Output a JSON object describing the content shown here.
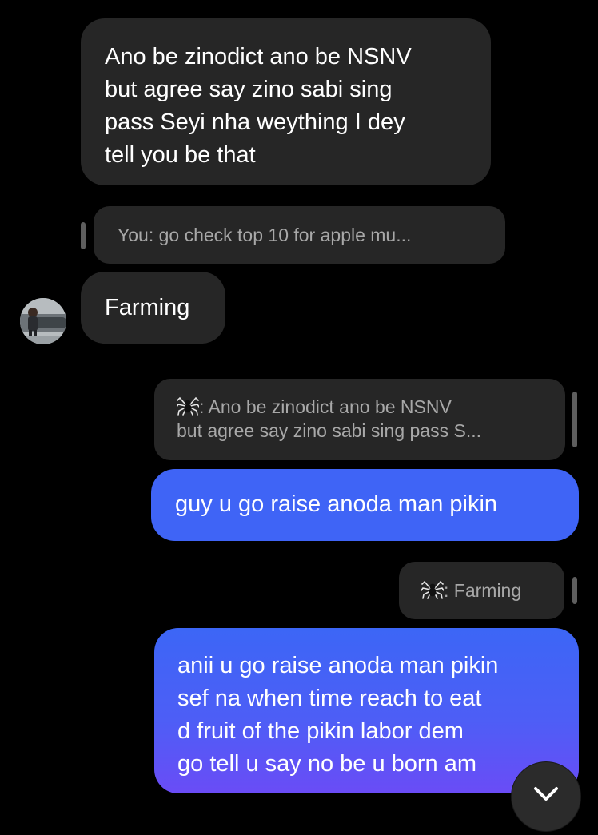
{
  "messages": [
    {
      "type": "incoming",
      "lines": [
        "Ano be zinodict ano be NSNV",
        "but agree say zino sabi sing",
        "pass Seyi nha weything I dey",
        "tell you be that"
      ]
    },
    {
      "type": "reply_preview_incoming",
      "text": "You: go check top 10 for apple mu..."
    },
    {
      "type": "incoming",
      "text": "Farming"
    },
    {
      "type": "reply_preview_outgoing",
      "line1": ": Ano be zinodict ano be NSNV",
      "line2": "but agree say zino sabi sing pass S..."
    },
    {
      "type": "outgoing",
      "text": "guy u go raise anoda man pikin"
    },
    {
      "type": "reply_preview_outgoing",
      "text": ": Farming"
    },
    {
      "type": "outgoing",
      "lines": [
        "anii u go raise anoda man pikin",
        "sef na when time reach to eat",
        "d fruit of the pikin labor dem",
        "go tell u say no be u born am"
      ]
    }
  ],
  "icons": {
    "reply_preview_emoji": "spider-emoji-icon",
    "scroll": "chevron-down-icon"
  },
  "colors": {
    "background": "#000000",
    "incoming_bubble": "#262626",
    "outgoing_gradient_start": "#3c66f6",
    "outgoing_gradient_end": "#6a4cf6",
    "preview_text": "#a8a8a8"
  }
}
